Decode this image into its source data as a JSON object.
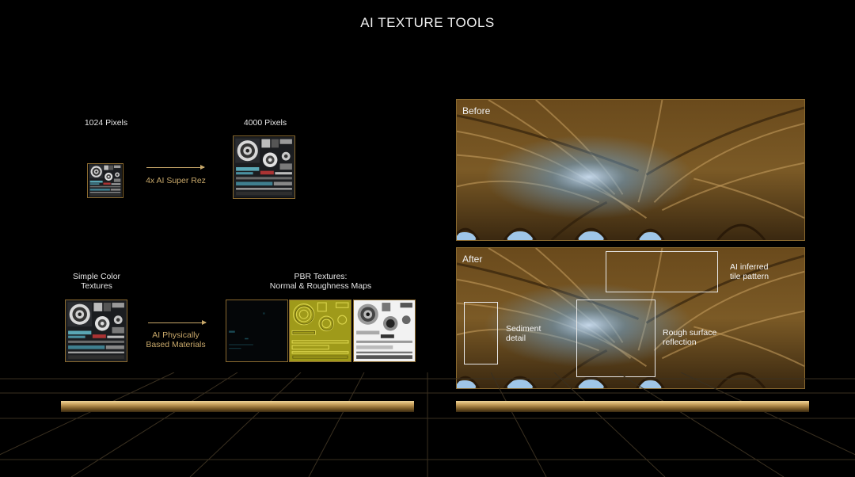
{
  "title": "AI TEXTURE TOOLS",
  "left": {
    "label_1024": "1024 Pixels",
    "label_4000": "4000 Pixels",
    "arrow_superrez": "4x AI Super Rez",
    "label_simple": "Simple Color\nTextures",
    "label_pbr": "PBR Textures:\nNormal & Roughness Maps",
    "arrow_pbm": "AI Physically\nBased Materials"
  },
  "right": {
    "before_label": "Before",
    "after_label": "After",
    "callouts": {
      "tile": "AI inferred\ntile pattern",
      "sediment": "Sediment\ndetail",
      "rough": "Rough surface\nreflection"
    }
  },
  "colors": {
    "accent_gold": "#c8a86a",
    "frame_gold": "#8a6a30",
    "background": "#000000"
  }
}
